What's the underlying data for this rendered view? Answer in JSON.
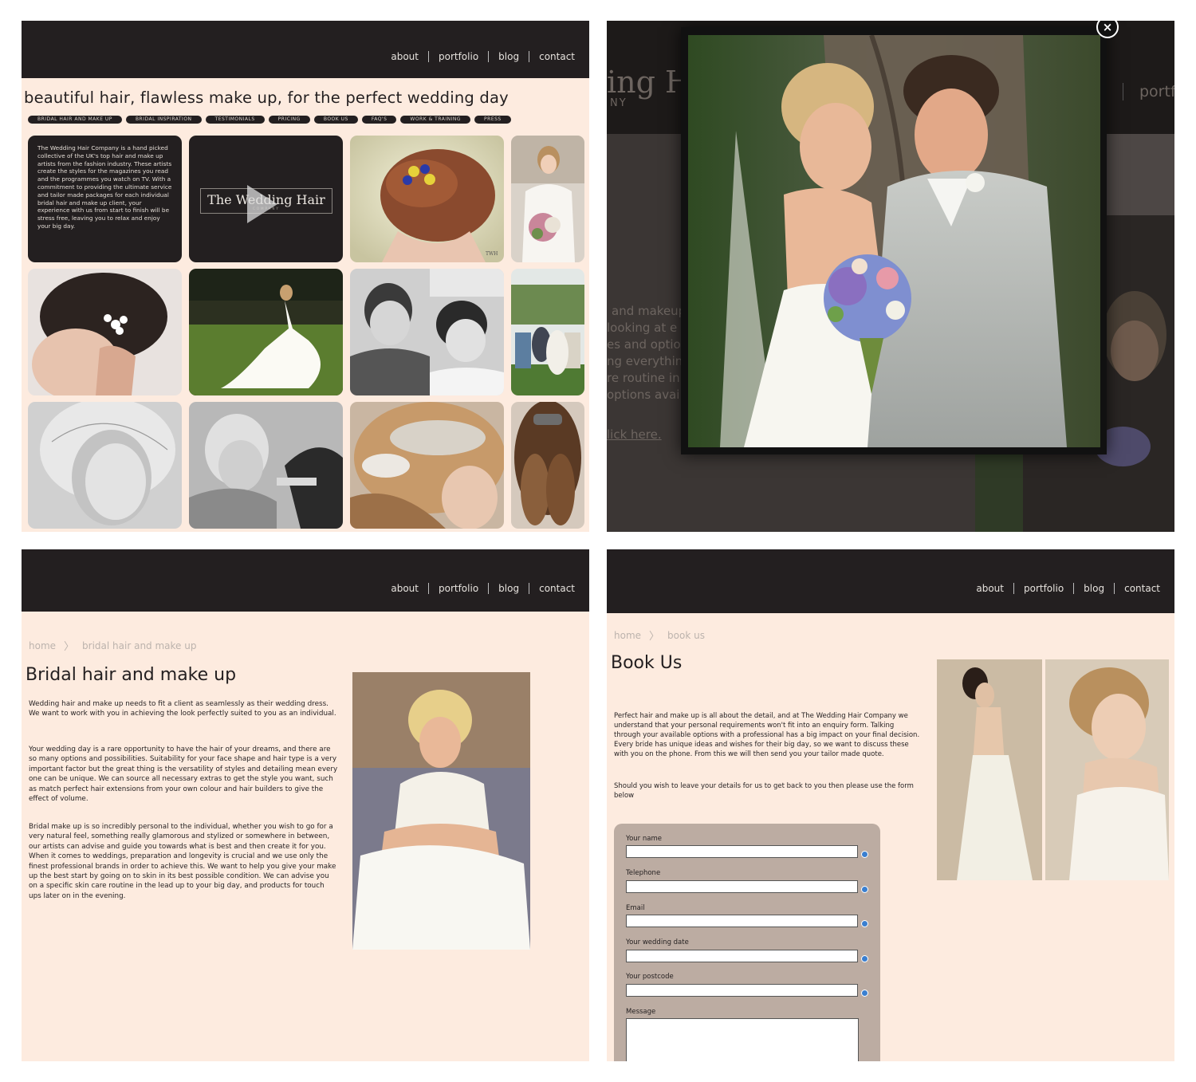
{
  "nav": [
    "about",
    "portfolio",
    "blog",
    "contact"
  ],
  "home_panel": {
    "tagline": "beautiful hair, flawless make up, for the perfect wedding day",
    "categories": [
      "BRIDAL HAIR AND MAKE UP",
      "BRIDAL INSPIRATION",
      "TESTIMONIALS",
      "PRICING",
      "BOOK US",
      "FAQ'S",
      "WORK & TRAINING",
      "PRESS"
    ],
    "intro": "The Wedding Hair Company is a hand picked collective of the UK's top hair and make up artists from the fashion industry. These artists create the styles for the magazines you read and the programmes you watch on TV. With a commitment to providing the ultimate service and tailor made packages for each individual bridal hair and make up client, your experience with us from start to finish will be stress free, leaving you to relax and enjoy your big day.",
    "video_logo": "The Wedding Hair",
    "video_logo_sub": "COMPANY",
    "watermark": "TWH"
  },
  "lightbox_panel": {
    "close_label": "×",
    "bg_logo": "ing H",
    "bg_logo_sub": "NY",
    "bg_nav": "portf",
    "bg_lines": [
      "and makeup",
      "looking at e",
      "es and optio",
      "ng everything",
      "re routine in",
      "options avai"
    ],
    "bg_link": "lick here."
  },
  "bridal_panel": {
    "breadcrumb": [
      "home",
      "bridal hair and make up"
    ],
    "title": "Bridal hair and make up",
    "paragraphs": [
      "Wedding hair and make up needs to fit a client as seamlessly as their wedding dress. We want to work with you in achieving the look perfectly suited to you as an individual.",
      "Your wedding day is a rare opportunity to have the hair of your dreams, and there are so many options and possibilities. Suitability for your face shape and hair type is a very important factor but the great thing is the versatility of styles and detailing mean every one can be unique. We can source all necessary extras to get the style you want, such as match perfect hair extensions from your own colour and hair builders to give the effect of volume.",
      "Bridal make up is so incredibly personal to the individual, whether you wish to go for a very natural feel, something really glamorous and stylized or somewhere in between, our artists can advise and guide you towards what is best and then create it for you. When it comes to weddings, preparation and longevity is crucial and we use only the finest professional brands in order to achieve this. We want to help you give your make up the best start by going on to skin in its best possible condition. We can advise you on a specific skin care routine in the lead up to your big day, and products for touch ups later on in the evening."
    ]
  },
  "book_panel": {
    "breadcrumb": [
      "home",
      "book us"
    ],
    "title": "Book Us",
    "paragraphs": [
      "Perfect hair and make up is all about the detail, and at The Wedding Hair Company we understand that your personal requirements won't fit into an enquiry form. Talking through your available options with a professional has a big impact on your final decision. Every bride has unique ideas and wishes for their big day, so we want to discuss these with you on the phone. From this we will then send you your tailor made quote.",
      "Should you wish to leave your details for us to get back to you then please use the form below"
    ],
    "form": {
      "name_label": "Your name",
      "phone_label": "Telephone",
      "email_label": "Email",
      "date_label": "Your wedding date",
      "postcode_label": "Your postcode",
      "message_label": "Message"
    }
  }
}
